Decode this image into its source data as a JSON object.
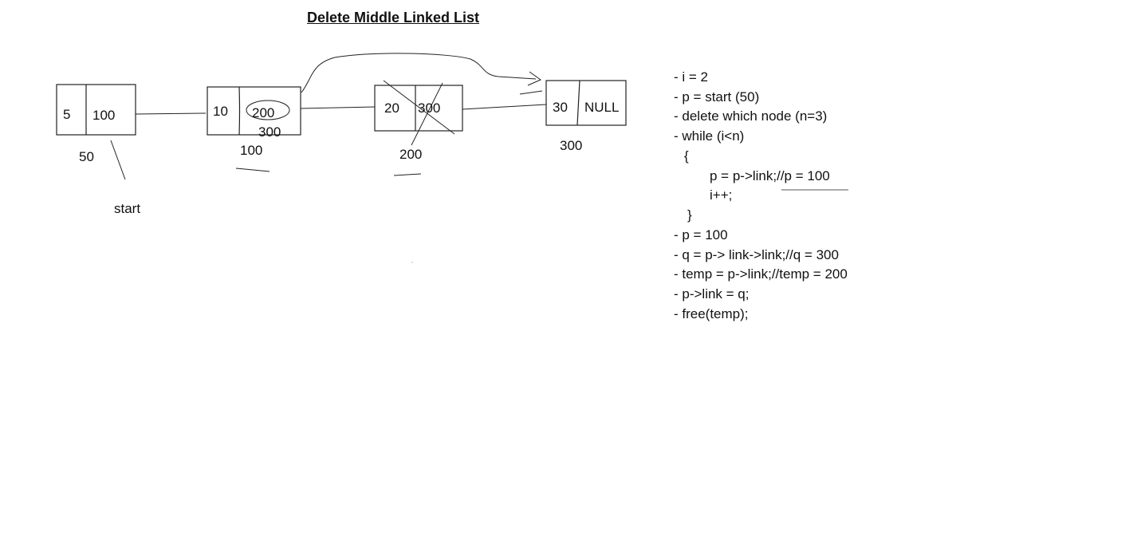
{
  "title": "Delete Middle Linked List",
  "nodes": [
    {
      "data": "5",
      "link": "100",
      "address": "50"
    },
    {
      "data": "10",
      "link": "200",
      "link_new": "300",
      "address": "100"
    },
    {
      "data": "20",
      "link": "300",
      "address": "200",
      "deleted": true
    },
    {
      "data": "30",
      "link": "NULL",
      "address": "300"
    }
  ],
  "start_label": "start",
  "code": [
    "- i = 2",
    "- p = start (50)",
    "- delete which node (n=3)",
    "- while (i<n)",
    "{",
    "p = p->link;//p = 100",
    "i++;",
    "}",
    "- p = 100",
    "- q = p-> link->link;//q = 300",
    "- temp = p->link;//temp = 200",
    "- p->link = q;",
    "- free(temp);"
  ]
}
